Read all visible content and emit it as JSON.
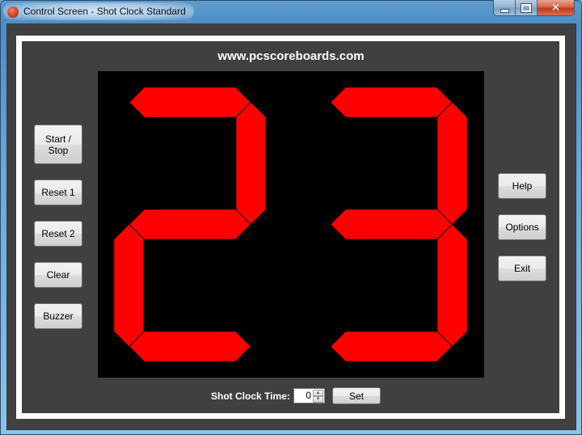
{
  "window": {
    "title": "Control Screen - Shot Clock Standard",
    "app_icon": "basketball-icon",
    "controls": {
      "minimize": "minimize-icon",
      "maximize": "maximize-icon",
      "close": "close-icon",
      "close_glyph": "✕"
    }
  },
  "header": {
    "site": "www.pcscoreboards.com"
  },
  "display": {
    "value": "23",
    "digits": [
      2,
      3
    ],
    "segment_color": "#ff0000",
    "background": "#000000"
  },
  "left_buttons": [
    {
      "id": "start-stop",
      "label": "Start /\nStop"
    },
    {
      "id": "reset-1",
      "label": "Reset 1"
    },
    {
      "id": "reset-2",
      "label": "Reset 2"
    },
    {
      "id": "clear",
      "label": "Clear"
    },
    {
      "id": "buzzer",
      "label": "Buzzer"
    }
  ],
  "right_buttons": [
    {
      "id": "help",
      "label": "Help"
    },
    {
      "id": "options",
      "label": "Options"
    },
    {
      "id": "exit",
      "label": "Exit"
    }
  ],
  "footer": {
    "time_label": "Shot Clock Time:",
    "time_value": "0",
    "set_label": "Set"
  }
}
